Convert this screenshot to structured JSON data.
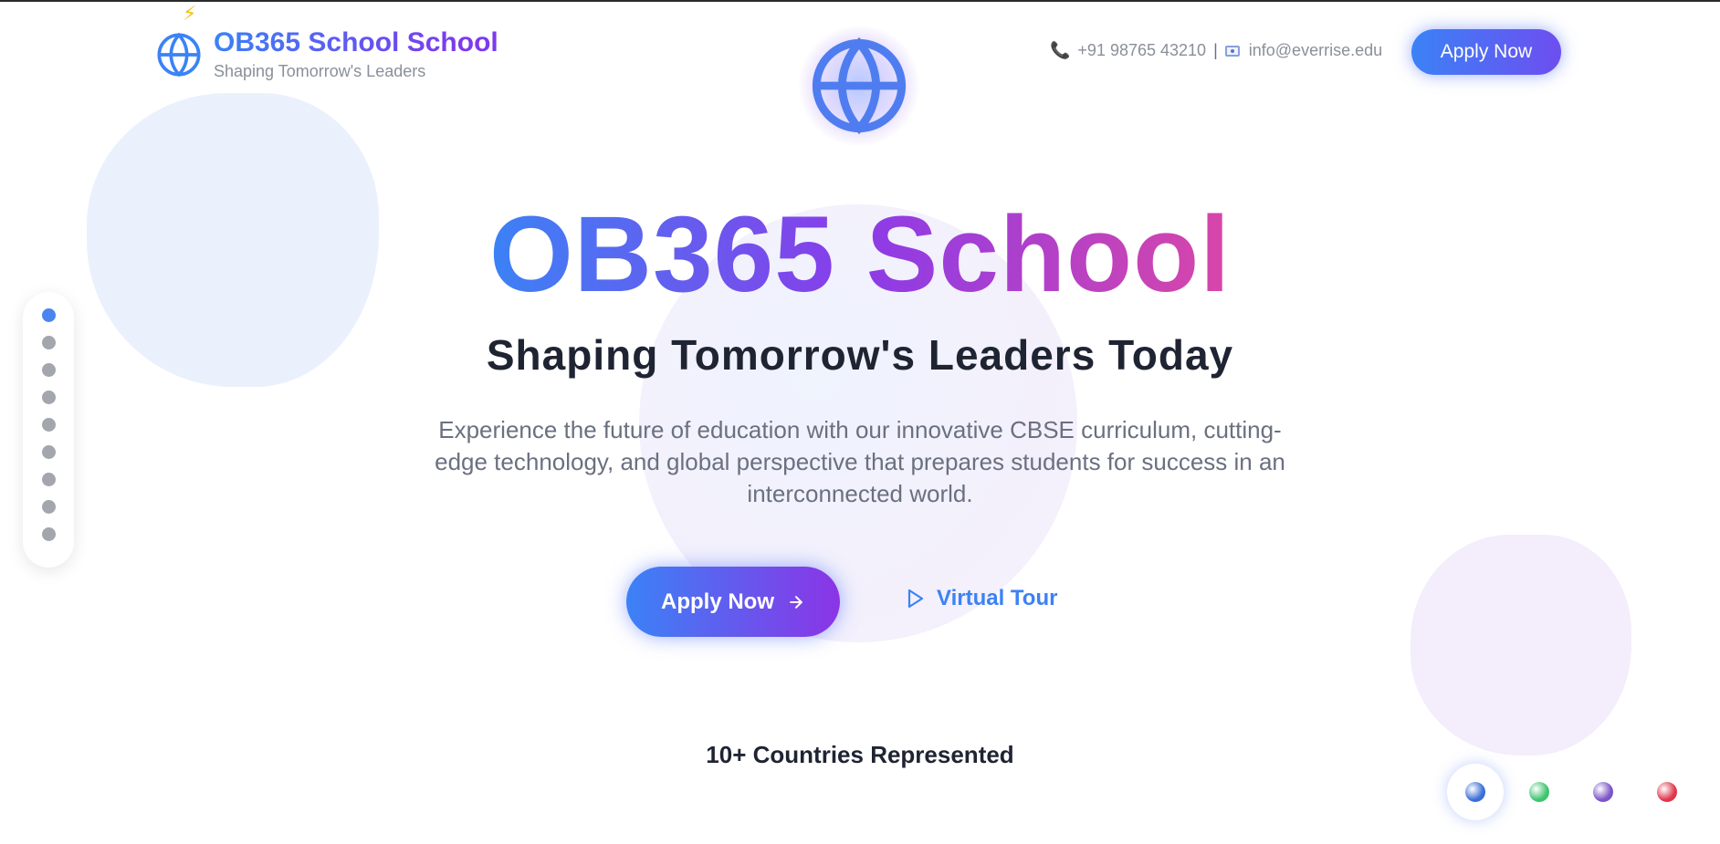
{
  "header": {
    "brand_title": "OB365 School School",
    "brand_subtitle": "Shaping Tomorrow's Leaders",
    "phone": "+91 98765 43210",
    "separator": "|",
    "email": "info@everrise.edu",
    "apply_label": "Apply Now"
  },
  "hero": {
    "title": "OB365 School",
    "subtitle": "Shaping Tomorrow's Leaders Today",
    "description": "Experience the future of education with our innovative CBSE curriculum, cutting-edge technology, and global perspective that prepares students for success in an interconnected world.",
    "apply_label": "Apply Now",
    "tour_label": "Virtual Tour"
  },
  "stat": {
    "text": "10+ Countries Represented"
  },
  "side_nav": {
    "dots": [
      {
        "active": true
      },
      {
        "active": false
      },
      {
        "active": false
      },
      {
        "active": false
      },
      {
        "active": false
      },
      {
        "active": false
      },
      {
        "active": false
      },
      {
        "active": false
      },
      {
        "active": false
      }
    ]
  },
  "theme_switcher": {
    "colors": [
      "#3b6fd6",
      "#3ec46e",
      "#7c55c8",
      "#e0364a"
    ],
    "active_index": 0
  },
  "icons": {
    "logo": "globe-icon",
    "badge": "bolt-icon",
    "hero": "globe-icon",
    "phone": "phone-icon",
    "email": "mail-icon",
    "apply_arrow": "arrow-right-icon",
    "tour": "play-icon"
  },
  "colors": {
    "primary": "#3b82f6",
    "secondary": "#7c3aed",
    "accent": "#d946a8",
    "text_dark": "#1f2433",
    "text_muted": "#6b7080"
  }
}
